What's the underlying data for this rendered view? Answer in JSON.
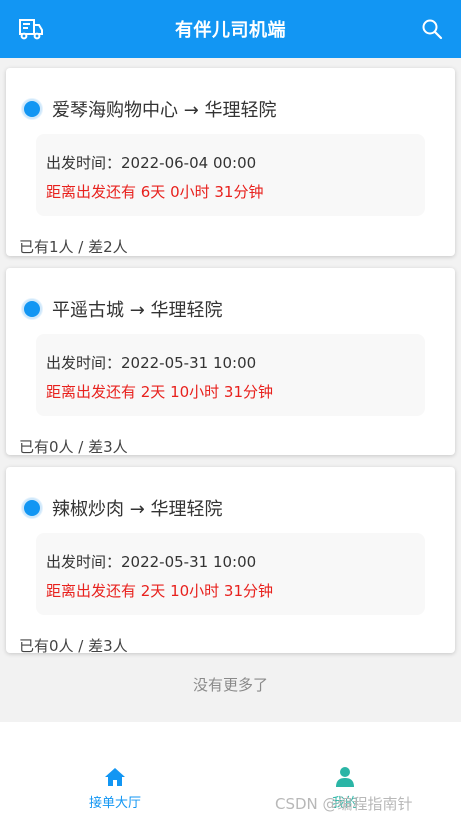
{
  "header": {
    "title": "有伴儿司机端",
    "left_icon": "car-list-icon",
    "right_icon": "search-icon"
  },
  "orders": [
    {
      "route": "爱琴海购物中心 → 华理轻院",
      "depart": "出发时间：2022-06-04 00:00",
      "countdown": "距离出发还有 6天 0小时 31分钟",
      "seats": "已有1人 / 差2人"
    },
    {
      "route": "平遥古城 → 华理轻院",
      "depart": "出发时间：2022-05-31 10:00",
      "countdown": "距离出发还有 2天 10小时 31分钟",
      "seats": "已有0人 / 差3人"
    },
    {
      "route": "辣椒炒肉 → 华理轻院",
      "depart": "出发时间：2022-05-31 10:00",
      "countdown": "距离出发还有 2天 10小时 31分钟",
      "seats": "已有0人 / 差3人"
    }
  ],
  "no_more": "没有更多了",
  "tabbar": {
    "home": {
      "label": "接单大厅",
      "icon": "home-icon"
    },
    "me": {
      "label": "我的",
      "icon": "user-icon"
    }
  },
  "watermark": "CSDN @编程指南针",
  "colors": {
    "primary": "#1296f3",
    "countdown": "#e8211d",
    "me_tab": "#2bb5a6"
  }
}
